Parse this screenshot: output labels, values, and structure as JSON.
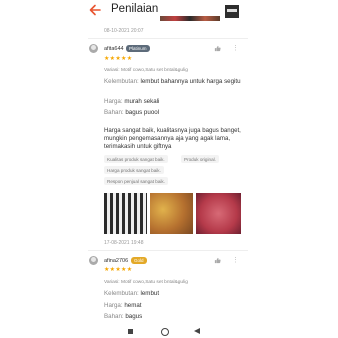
{
  "header": {
    "title": "Penilaian"
  },
  "reviews": [
    {
      "date": "08-10-2021 20:07"
    },
    {
      "username": "afita644",
      "badge": "Platinum",
      "stars": "★★★★★",
      "variant": "Variasi: Motif cowo,Satu set bntal&gulig",
      "kelembutan_label": "Kelembutan:",
      "kelembutan_value": "lembut bahannya untuk harga segitu",
      "harga_label": "Harga:",
      "harga_value": "murah sekali",
      "bahan_label": "Bahan:",
      "bahan_value": "bagus puool",
      "text": "Harga sangat baik, kualitasnya juga bagus banget, mungkin pengemasannya aja yang agak lama, terimakasih untuk giftnya",
      "tags": [
        "Kualitas produk sangat baik.",
        "Produk original.",
        "Harga produk sangat baik.",
        "Respon penjual sangat baik."
      ],
      "date": "17-08-2021 19:48"
    },
    {
      "username": "afina2706",
      "badge": "Gold",
      "stars": "★★★★★",
      "variant": "Variasi: Motif cowo,Satu set bntal&gulig",
      "kelembutan_label": "Kelembutan:",
      "kelembutan_value": "lembut",
      "harga_label": "Harga:",
      "harga_value": "hemat",
      "bahan_label": "Bahan:",
      "bahan_value": "bagus"
    }
  ]
}
